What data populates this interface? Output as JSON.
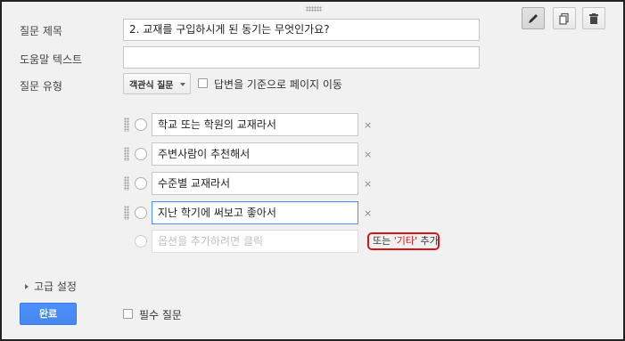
{
  "form": {
    "title_label": "질문 제목",
    "title_value": "2. 교재를 구입하시게 된 동기는 무엇인가요?",
    "help_label": "도움말 텍스트",
    "help_value": "",
    "type_label": "질문 유형",
    "type_value": "객관식 질문",
    "page_nav_label": "답변을 기준으로 페이지 이동"
  },
  "toolbar": {
    "edit_icon": "pencil-icon",
    "copy_icon": "copy-icon",
    "delete_icon": "trash-icon"
  },
  "options": [
    "학교 또는 학원의 교재라서",
    "주변사람이 추천해서",
    "수준별 교재라서",
    "지난 학기에 써보고 좋아서"
  ],
  "remove_symbol": "×",
  "add_option_placeholder": "옵션을 추가하려면 클릭",
  "other_link": {
    "prefix": "또는 ",
    "highlight": "'기타'",
    "suffix": " 추가"
  },
  "advanced_label": "고급 설정",
  "done_label": "완료",
  "required_label": "필수 질문",
  "colors": {
    "accent_blue": "#4d90fe",
    "highlight_red": "#d8141b",
    "panel_bg": "#f1f1f1"
  }
}
